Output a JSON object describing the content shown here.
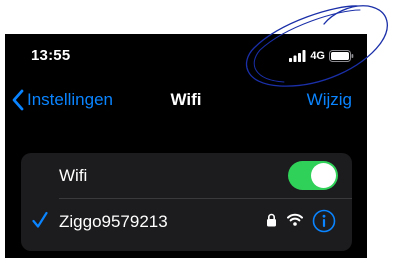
{
  "status_bar": {
    "time": "13:55",
    "network": "4G",
    "icons": [
      "signal-bars-icon",
      "battery-icon"
    ]
  },
  "nav": {
    "back_label": "Instellingen",
    "title": "Wifi",
    "edit_label": "Wijzig",
    "back_icon": "chevron-left-icon"
  },
  "wifi_row": {
    "label": "Wifi",
    "enabled": true
  },
  "network_row": {
    "name": "Ziggo9579213",
    "connected": true,
    "secured": true,
    "icons": [
      "checkmark-icon",
      "lock-icon",
      "wifi-signal-icon",
      "info-icon"
    ]
  },
  "colors": {
    "background": "#000000",
    "group_background": "#1c1c1e",
    "accent": "#0a84ff",
    "toggle_on": "#30d158",
    "text": "#ffffff",
    "annotation": "#1a2fa8"
  }
}
